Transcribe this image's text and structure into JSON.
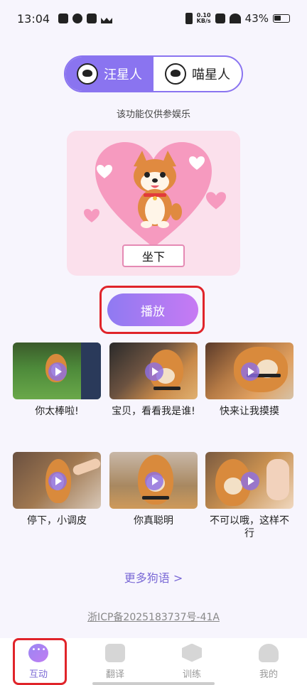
{
  "status_bar": {
    "time": "13:04",
    "speed_value": "0.10",
    "speed_unit": "KB/s",
    "battery": "43%"
  },
  "toggle": {
    "dog_label": "汪星人",
    "cat_label": "喵星人",
    "active": "dog"
  },
  "disclaimer": "该功能仅供参娱乐",
  "hero": {
    "command": "坐下"
  },
  "play_button": "播放",
  "phrases": [
    {
      "caption": "你太棒啦!"
    },
    {
      "caption": "宝贝，看看我是谁!"
    },
    {
      "caption": "快来让我摸摸"
    },
    {
      "caption": "停下，小调皮"
    },
    {
      "caption": "你真聪明"
    },
    {
      "caption": "不可以哦，这样不行"
    }
  ],
  "more_link": "更多狗语 >",
  "icp": "浙ICP备2025183737号-41A",
  "tabs": [
    {
      "label": "互动",
      "icon": "chat-icon"
    },
    {
      "label": "翻译",
      "icon": "translate-icon"
    },
    {
      "label": "训练",
      "icon": "training-icon"
    },
    {
      "label": "我的",
      "icon": "profile-icon"
    }
  ],
  "colors": {
    "accent": "#8a74f0",
    "highlight": "#e0242a"
  }
}
